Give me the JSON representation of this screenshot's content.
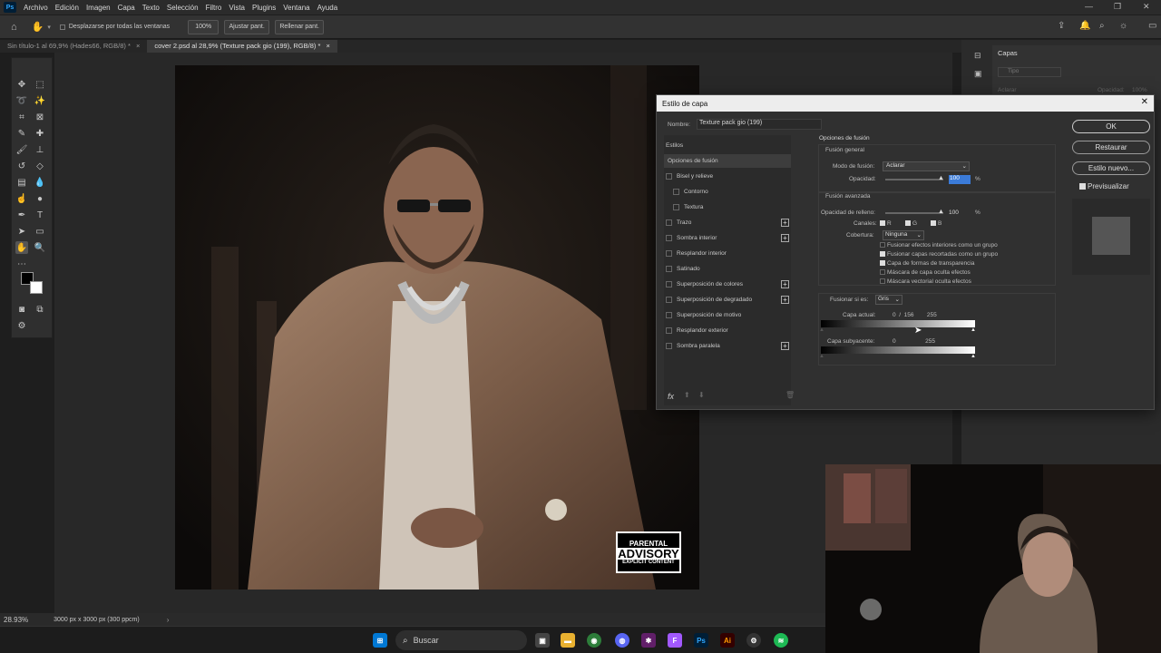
{
  "menubar": {
    "app_icon": "Ps",
    "items": [
      "Archivo",
      "Edición",
      "Imagen",
      "Capa",
      "Texto",
      "Selección",
      "Filtro",
      "Vista",
      "Plugins",
      "Ventana",
      "Ayuda"
    ]
  },
  "optionsbar": {
    "scroll_all_label": "Desplazarse por todas las ventanas",
    "zoom_100": "100%",
    "fit_screen": "Ajustar pant.",
    "fill_screen": "Rellenar pant."
  },
  "tabs": [
    {
      "label": "Sin título-1 al 69,9% (Hades66, RGB/8) *",
      "close": "×"
    },
    {
      "label": "cover 2.psd al 28,9% (Texture pack gio (199), RGB/8) *",
      "close": "×"
    }
  ],
  "artwork": {
    "advisory_line1": "PARENTAL",
    "advisory_line2": "ADVISORY",
    "advisory_line3": "EXPLICIT CONTENT"
  },
  "status": {
    "zoom": "28.93%",
    "doc_info": "3000 px x 3000 px (300 ppcm)"
  },
  "layers_panel": {
    "title": "Capas",
    "search_placeholder": "Tipo",
    "blend": "Aclarar",
    "opacity_label": "Opacidad:",
    "opacity_value": "100%"
  },
  "dialog": {
    "title": "Estilo de capa",
    "name_label": "Nombre:",
    "name_value": "Texture pack gio (199)",
    "styles_header": "Estilos",
    "styles": [
      {
        "label": "Opciones de fusión",
        "checkbox": false,
        "plus": false,
        "selected": true
      },
      {
        "label": "Bisel y relieve",
        "checkbox": true,
        "plus": false
      },
      {
        "label": "Contorno",
        "checkbox": true,
        "plus": false,
        "indent": true
      },
      {
        "label": "Textura",
        "checkbox": true,
        "plus": false,
        "indent": true
      },
      {
        "label": "Trazo",
        "checkbox": true,
        "plus": true
      },
      {
        "label": "Sombra interior",
        "checkbox": true,
        "plus": true
      },
      {
        "label": "Resplandor interior",
        "checkbox": true,
        "plus": false
      },
      {
        "label": "Satinado",
        "checkbox": true,
        "plus": false
      },
      {
        "label": "Superposición de colores",
        "checkbox": true,
        "plus": true
      },
      {
        "label": "Superposición de degradado",
        "checkbox": true,
        "plus": true
      },
      {
        "label": "Superposición de motivo",
        "checkbox": true,
        "plus": false
      },
      {
        "label": "Resplandor exterior",
        "checkbox": true,
        "plus": false
      },
      {
        "label": "Sombra paralela",
        "checkbox": true,
        "plus": true
      }
    ],
    "fx_label": "fx",
    "blend_options": {
      "section": "Opciones de fusión",
      "general": "Fusión general",
      "mode_label": "Modo de fusión:",
      "mode_value": "Aclarar",
      "opacity_label": "Opacidad:",
      "opacity_value": "100",
      "percent": "%",
      "advanced": "Fusión avanzada",
      "fill_opacity_label": "Opacidad de relleno:",
      "fill_opacity_value": "100",
      "channels_label": "Canales:",
      "channels": [
        "R",
        "G",
        "B"
      ],
      "knockout_label": "Cobertura:",
      "knockout_value": "Ninguna",
      "options": [
        {
          "label": "Fusionar efectos interiores como un grupo",
          "checked": false
        },
        {
          "label": "Fusionar capas recortadas como un grupo",
          "checked": true
        },
        {
          "label": "Capa de formas de transparencia",
          "checked": true
        },
        {
          "label": "Máscara de capa oculta efectos",
          "checked": false
        },
        {
          "label": "Máscara vectorial oculta efectos",
          "checked": false
        }
      ],
      "blend_if_label": "Fusionar si es:",
      "blend_if_value": "Gris",
      "this_layer_label": "Capa actual:",
      "this_layer_values": "0  /  156        255",
      "underlying_label": "Capa subyacente:",
      "underlying_values": "0                  255"
    },
    "buttons": {
      "ok": "OK",
      "reset": "Restaurar",
      "new_style": "Estilo nuevo...",
      "preview": "Previsualizar"
    }
  },
  "taskbar": {
    "search_label": "Buscar"
  }
}
